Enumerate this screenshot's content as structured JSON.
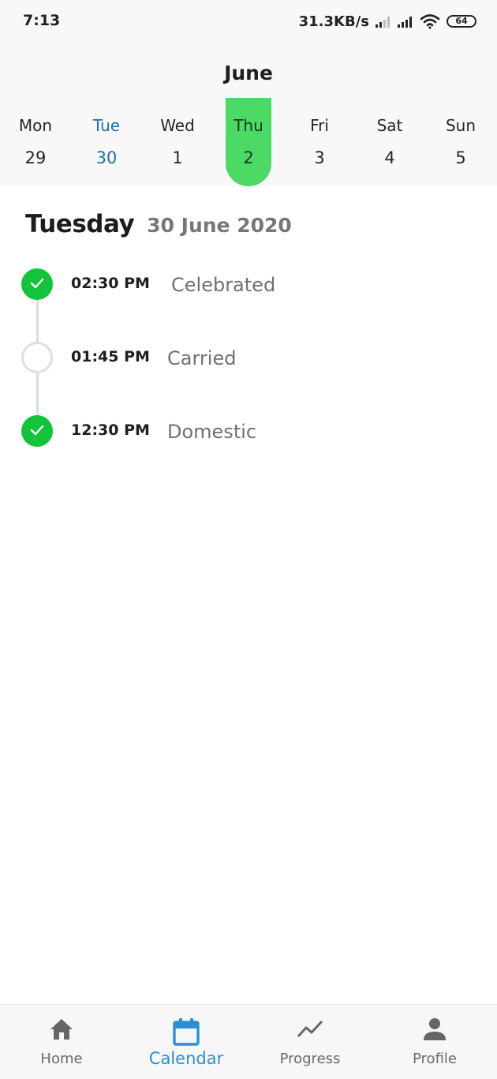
{
  "status_bar": {
    "time": "7:13",
    "net_speed": "31.3KB/s",
    "battery": "64"
  },
  "calendar": {
    "month": "June",
    "days": [
      {
        "name": "Mon",
        "num": "29",
        "state": "normal"
      },
      {
        "name": "Tue",
        "num": "30",
        "state": "today"
      },
      {
        "name": "Wed",
        "num": "1",
        "state": "normal"
      },
      {
        "name": "Thu",
        "num": "2",
        "state": "selected"
      },
      {
        "name": "Fri",
        "num": "3",
        "state": "normal"
      },
      {
        "name": "Sat",
        "num": "4",
        "state": "normal"
      },
      {
        "name": "Sun",
        "num": "5",
        "state": "normal"
      }
    ]
  },
  "date_heading": {
    "weekday": "Tuesday",
    "full_date": "30 June 2020"
  },
  "timeline": [
    {
      "time": "02:30 PM",
      "label": "Celebrated",
      "done": true
    },
    {
      "time": "01:45 PM",
      "label": "Carried",
      "done": false
    },
    {
      "time": "12:30 PM",
      "label": "Domestic",
      "done": true
    }
  ],
  "nav": {
    "items": [
      {
        "label": "Home",
        "icon": "home-icon"
      },
      {
        "label": "Calendar",
        "icon": "calendar-icon"
      },
      {
        "label": "Progress",
        "icon": "progress-icon"
      },
      {
        "label": "Profile",
        "icon": "profile-icon"
      }
    ],
    "active": "Calendar"
  },
  "colors": {
    "accent_green": "#4cd964",
    "check_green": "#12c43a",
    "today_blue": "#1f6fb5",
    "nav_active_blue": "#2b8fd6"
  }
}
